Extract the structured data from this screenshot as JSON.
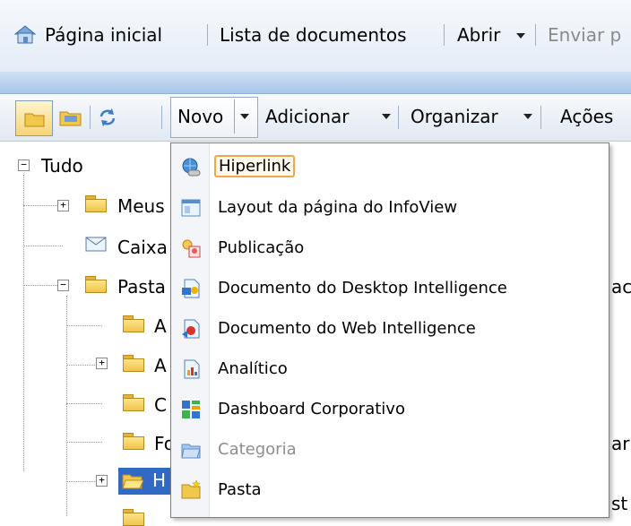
{
  "topnav": {
    "home": "Página inicial",
    "doc_list": "Lista de documentos",
    "open": "Abrir",
    "send": "Enviar p"
  },
  "toolbar": {
    "new": "Novo",
    "add": "Adicionar",
    "organize": "Organizar",
    "actions": "Ações"
  },
  "tree": {
    "root": "Tudo",
    "items": [
      "Meus",
      "Caixa",
      "Pasta",
      "A",
      "A",
      "C",
      "Fo",
      "H"
    ],
    "right_clips": [
      "ac",
      "ar",
      "st"
    ]
  },
  "menu": {
    "items": [
      {
        "label": "Hiperlink",
        "icon": "hyperlink-icon",
        "state": "highlighted"
      },
      {
        "label": "Layout da página do InfoView",
        "icon": "page-layout-icon",
        "state": "normal"
      },
      {
        "label": "Publicação",
        "icon": "publication-icon",
        "state": "normal"
      },
      {
        "label": "Documento do Desktop Intelligence",
        "icon": "desktop-intelligence-icon",
        "state": "normal"
      },
      {
        "label": "Documento do Web Intelligence",
        "icon": "web-intelligence-icon",
        "state": "normal"
      },
      {
        "label": "Analítico",
        "icon": "analytic-icon",
        "state": "normal"
      },
      {
        "label": "Dashboard Corporativo",
        "icon": "dashboard-icon",
        "state": "normal"
      },
      {
        "label": "Categoria",
        "icon": "category-icon",
        "state": "disabled"
      },
      {
        "label": "Pasta",
        "icon": "folder-new-icon",
        "state": "normal"
      }
    ]
  },
  "colors": {
    "accent": "#f0a64a",
    "selection": "#316ac5",
    "band": "#a9c6ea"
  }
}
